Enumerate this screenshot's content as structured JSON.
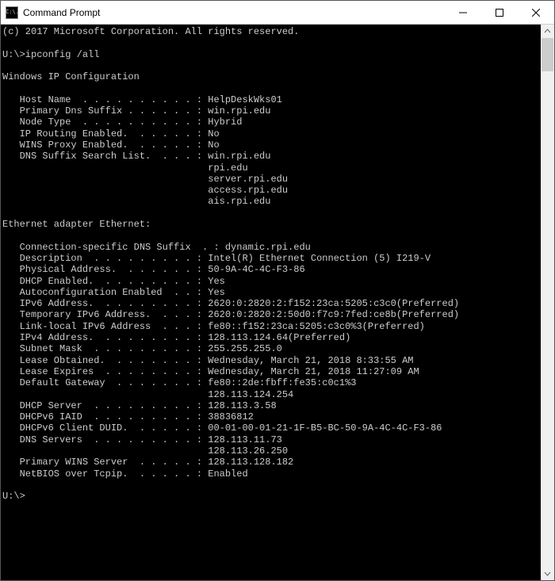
{
  "window": {
    "title": "Command Prompt",
    "icon_text": "C:\\."
  },
  "terminal": {
    "copyright": "(c) 2017 Microsoft Corporation. All rights reserved.",
    "prompt1": "U:\\>",
    "command": "ipconfig /all",
    "section_header": "Windows IP Configuration",
    "label_col_width": 33,
    "global_fields": [
      {
        "label": "Host Name",
        "values": [
          "HelpDeskWks01"
        ]
      },
      {
        "label": "Primary Dns Suffix",
        "values": [
          "win.rpi.edu"
        ]
      },
      {
        "label": "Node Type",
        "values": [
          "Hybrid"
        ]
      },
      {
        "label": "IP Routing Enabled.",
        "values": [
          "No"
        ]
      },
      {
        "label": "WINS Proxy Enabled.",
        "values": [
          "No"
        ]
      },
      {
        "label": "DNS Suffix Search List.",
        "values": [
          "win.rpi.edu",
          "rpi.edu",
          "server.rpi.edu",
          "access.rpi.edu",
          "ais.rpi.edu"
        ]
      }
    ],
    "adapter_header": "Ethernet adapter Ethernet:",
    "adapter_fields": [
      {
        "label": "Connection-specific DNS Suffix  .",
        "raw": true,
        "values": [
          "dynamic.rpi.edu"
        ]
      },
      {
        "label": "Description",
        "values": [
          "Intel(R) Ethernet Connection (5) I219-V"
        ]
      },
      {
        "label": "Physical Address.",
        "values": [
          "50-9A-4C-4C-F3-86"
        ]
      },
      {
        "label": "DHCP Enabled.",
        "values": [
          "Yes"
        ]
      },
      {
        "label": "Autoconfiguration Enabled",
        "values": [
          "Yes"
        ]
      },
      {
        "label": "IPv6 Address.",
        "values": [
          "2620:0:2820:2:f152:23ca:5205:c3c0(Preferred)"
        ]
      },
      {
        "label": "Temporary IPv6 Address.",
        "values": [
          "2620:0:2820:2:50d0:f7c9:7fed:ce8b(Preferred)"
        ]
      },
      {
        "label": "Link-local IPv6 Address",
        "values": [
          "fe80::f152:23ca:5205:c3c0%3(Preferred)"
        ]
      },
      {
        "label": "IPv4 Address.",
        "values": [
          "128.113.124.64(Preferred)"
        ]
      },
      {
        "label": "Subnet Mask",
        "values": [
          "255.255.255.0"
        ]
      },
      {
        "label": "Lease Obtained.",
        "values": [
          "Wednesday, March 21, 2018 8:33:55 AM"
        ]
      },
      {
        "label": "Lease Expires",
        "values": [
          "Wednesday, March 21, 2018 11:27:09 AM"
        ]
      },
      {
        "label": "Default Gateway",
        "values": [
          "fe80::2de:fbff:fe35:c0c1%3",
          "128.113.124.254"
        ]
      },
      {
        "label": "DHCP Server",
        "values": [
          "128.113.3.58"
        ]
      },
      {
        "label": "DHCPv6 IAID",
        "values": [
          "38836812"
        ]
      },
      {
        "label": "DHCPv6 Client DUID.",
        "values": [
          "00-01-00-01-21-1F-B5-BC-50-9A-4C-4C-F3-86"
        ]
      },
      {
        "label": "DNS Servers",
        "values": [
          "128.113.11.73",
          "128.113.26.250"
        ]
      },
      {
        "label": "Primary WINS Server",
        "values": [
          "128.113.128.182"
        ]
      },
      {
        "label": "NetBIOS over Tcpip.",
        "values": [
          "Enabled"
        ]
      }
    ],
    "prompt2": "U:\\>"
  }
}
